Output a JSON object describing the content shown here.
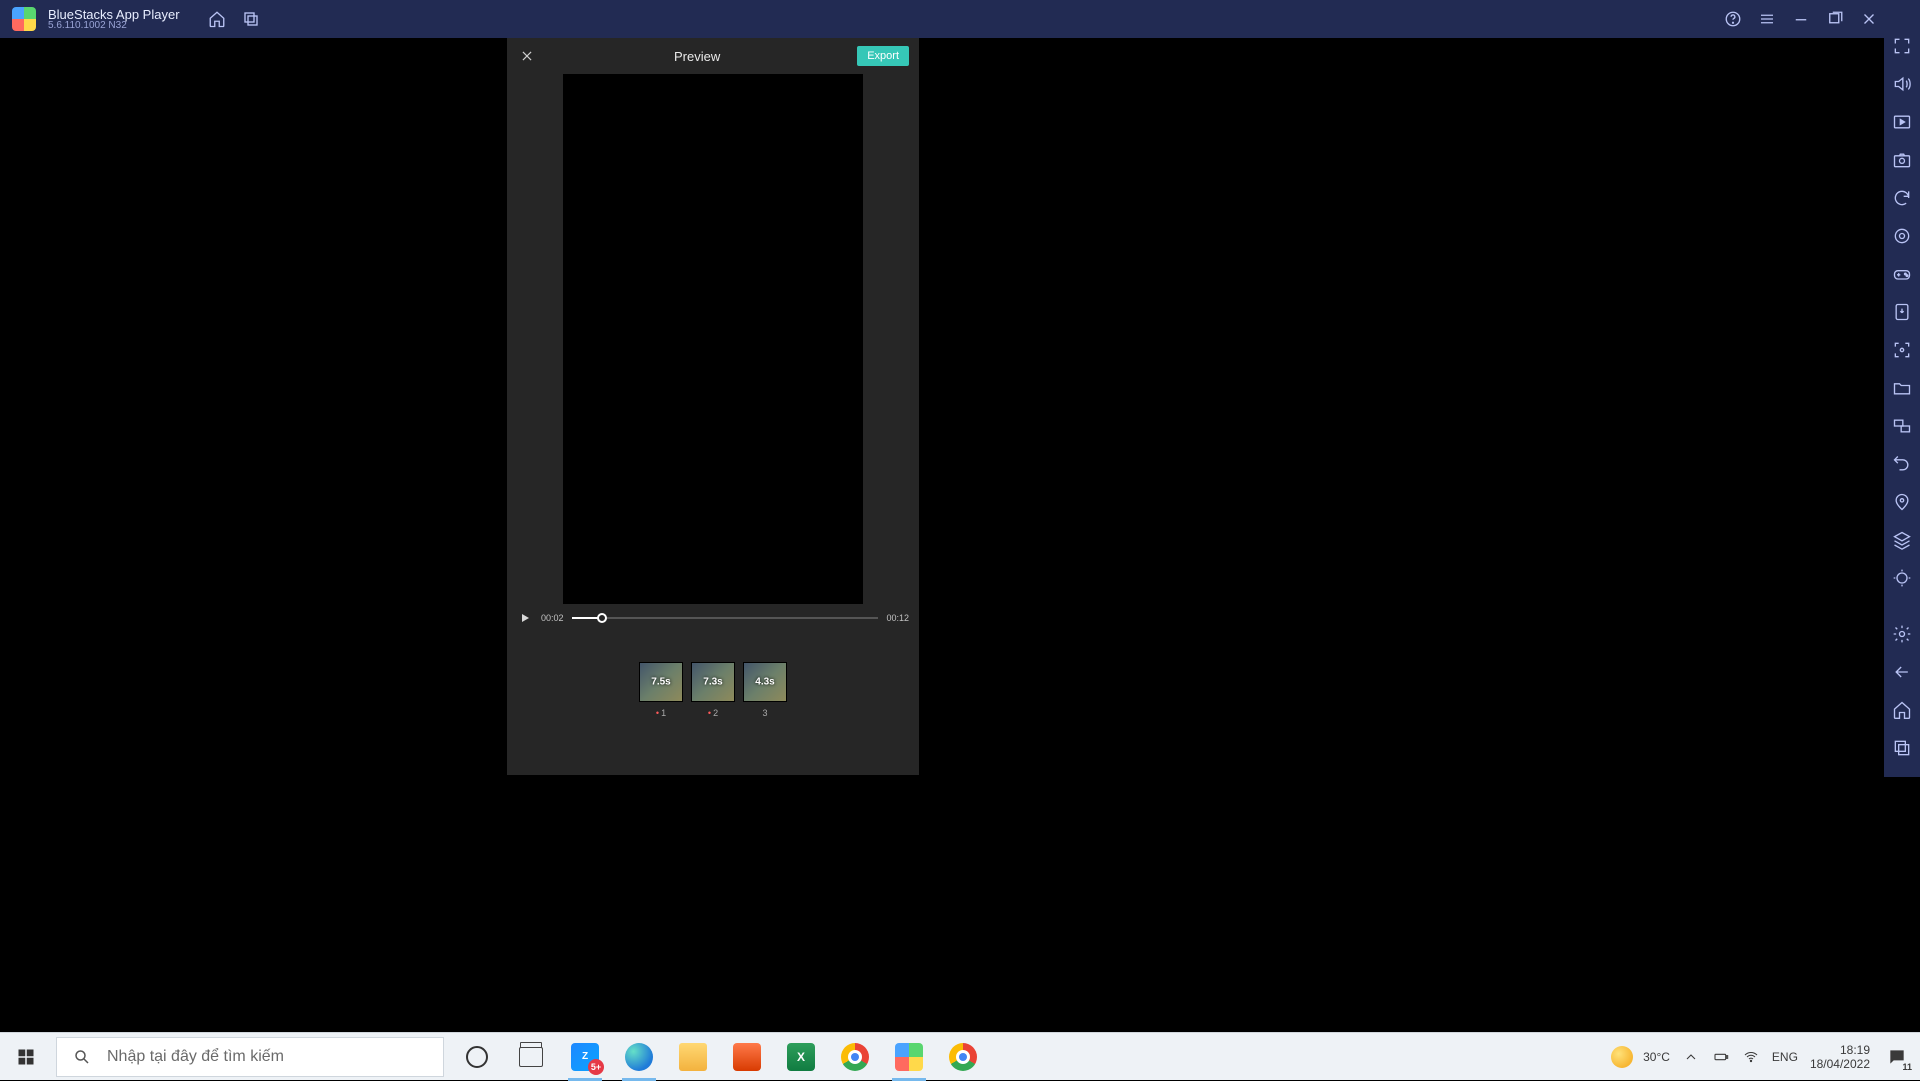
{
  "titlebar": {
    "app_name": "BlueStacks App Player",
    "version_line": "5.6.110.1002  N32"
  },
  "preview": {
    "title": "Preview",
    "export_label": "Export",
    "time_cur": "00:02",
    "time_dur": "00:12",
    "progress_pct": 10,
    "clips": [
      {
        "duration": "7.5s",
        "index": "1",
        "dotted": true
      },
      {
        "duration": "7.3s",
        "index": "2",
        "dotted": true
      },
      {
        "duration": "4.3s",
        "index": "3",
        "dotted": false
      }
    ]
  },
  "taskbar": {
    "search_placeholder": "Nhập tại đây để tìm kiếm",
    "zalo_badge": "5+",
    "weather_temp": "30°C",
    "ime_lang": "ENG",
    "time": "18:19",
    "date": "18/04/2022",
    "notif_count": "11"
  }
}
